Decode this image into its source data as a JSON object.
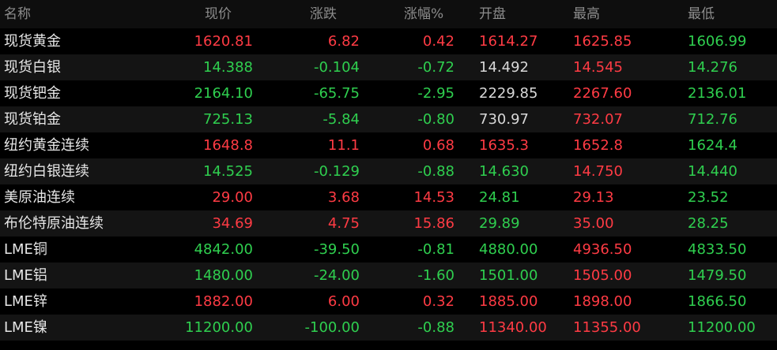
{
  "colors": {
    "up": "#ff3b44",
    "down": "#2fcf4f",
    "flat": "#d8d8d8",
    "header": "#8c8c8c",
    "background": "#000000",
    "row_alt": "#141414"
  },
  "headers": {
    "name": "名称",
    "price": "现价",
    "change": "涨跌",
    "pct": "涨幅%",
    "open": "开盘",
    "high": "最高",
    "low": "最低"
  },
  "rows": [
    {
      "name": "现货黄金",
      "price": "1620.81",
      "change": "6.82",
      "pct": "0.42",
      "open": "1614.27",
      "high": "1625.85",
      "low": "1606.99",
      "price_dir": "up",
      "change_dir": "up",
      "pct_dir": "up",
      "open_dir": "up",
      "high_dir": "up",
      "low_dir": "down"
    },
    {
      "name": "现货白银",
      "price": "14.388",
      "change": "-0.104",
      "pct": "-0.72",
      "open": "14.492",
      "high": "14.545",
      "low": "14.276",
      "price_dir": "down",
      "change_dir": "down",
      "pct_dir": "down",
      "open_dir": "flat",
      "high_dir": "up",
      "low_dir": "down"
    },
    {
      "name": "现货钯金",
      "price": "2164.10",
      "change": "-65.75",
      "pct": "-2.95",
      "open": "2229.85",
      "high": "2267.60",
      "low": "2136.01",
      "price_dir": "down",
      "change_dir": "down",
      "pct_dir": "down",
      "open_dir": "flat",
      "high_dir": "up",
      "low_dir": "down"
    },
    {
      "name": "现货铂金",
      "price": "725.13",
      "change": "-5.84",
      "pct": "-0.80",
      "open": "730.97",
      "high": "732.07",
      "low": "712.76",
      "price_dir": "down",
      "change_dir": "down",
      "pct_dir": "down",
      "open_dir": "flat",
      "high_dir": "up",
      "low_dir": "down"
    },
    {
      "name": "纽约黄金连续",
      "price": "1648.8",
      "change": "11.1",
      "pct": "0.68",
      "open": "1635.3",
      "high": "1652.8",
      "low": "1624.4",
      "price_dir": "up",
      "change_dir": "up",
      "pct_dir": "up",
      "open_dir": "up",
      "high_dir": "up",
      "low_dir": "down"
    },
    {
      "name": "纽约白银连续",
      "price": "14.525",
      "change": "-0.129",
      "pct": "-0.88",
      "open": "14.630",
      "high": "14.750",
      "low": "14.440",
      "price_dir": "down",
      "change_dir": "down",
      "pct_dir": "down",
      "open_dir": "down",
      "high_dir": "up",
      "low_dir": "down"
    },
    {
      "name": "美原油连续",
      "price": "29.00",
      "change": "3.68",
      "pct": "14.53",
      "open": "24.81",
      "high": "29.13",
      "low": "23.52",
      "price_dir": "up",
      "change_dir": "up",
      "pct_dir": "up",
      "open_dir": "down",
      "high_dir": "up",
      "low_dir": "down"
    },
    {
      "name": "布伦特原油连续",
      "price": "34.69",
      "change": "4.75",
      "pct": "15.86",
      "open": "29.89",
      "high": "35.00",
      "low": "28.25",
      "price_dir": "up",
      "change_dir": "up",
      "pct_dir": "up",
      "open_dir": "down",
      "high_dir": "up",
      "low_dir": "down"
    },
    {
      "name": "LME铜",
      "price": "4842.00",
      "change": "-39.50",
      "pct": "-0.81",
      "open": "4880.00",
      "high": "4936.50",
      "low": "4833.50",
      "price_dir": "down",
      "change_dir": "down",
      "pct_dir": "down",
      "open_dir": "down",
      "high_dir": "up",
      "low_dir": "down"
    },
    {
      "name": "LME铝",
      "price": "1480.00",
      "change": "-24.00",
      "pct": "-1.60",
      "open": "1501.00",
      "high": "1505.00",
      "low": "1479.50",
      "price_dir": "down",
      "change_dir": "down",
      "pct_dir": "down",
      "open_dir": "down",
      "high_dir": "up",
      "low_dir": "down"
    },
    {
      "name": "LME锌",
      "price": "1882.00",
      "change": "6.00",
      "pct": "0.32",
      "open": "1885.00",
      "high": "1898.00",
      "low": "1866.50",
      "price_dir": "up",
      "change_dir": "up",
      "pct_dir": "up",
      "open_dir": "up",
      "high_dir": "up",
      "low_dir": "down"
    },
    {
      "name": "LME镍",
      "price": "11200.00",
      "change": "-100.00",
      "pct": "-0.88",
      "open": "11340.00",
      "high": "11355.00",
      "low": "11200.00",
      "price_dir": "down",
      "change_dir": "down",
      "pct_dir": "down",
      "open_dir": "up",
      "high_dir": "up",
      "low_dir": "down"
    }
  ]
}
